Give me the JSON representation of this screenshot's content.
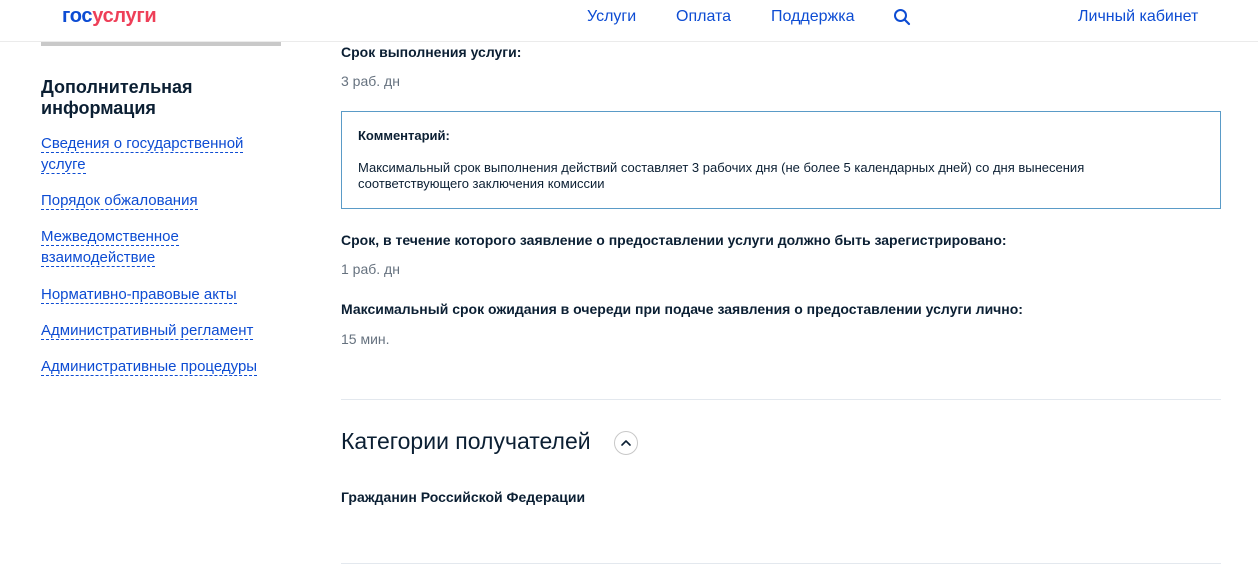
{
  "header": {
    "logo_part1": "гос",
    "logo_part2": "услуги",
    "nav": [
      "Услуги",
      "Оплата",
      "Поддержка"
    ],
    "account_link": "Личный кабинет",
    "search_icon": "search-icon"
  },
  "sidebar": {
    "title": "Дополнительная информация",
    "links": [
      "Сведения о государственной услуге",
      "Порядок обжалования",
      "Межведомственное взаимодействие",
      "Нормативно-правовые акты",
      "Административный регламент",
      "Административные процедуры"
    ]
  },
  "main": {
    "term_label": "Срок выполнения услуги:",
    "term_value": "3 раб. дн",
    "comment": {
      "title": "Комментарий:",
      "text": "Максимальный срок выполнения действий составляет 3 рабочих дня (не более 5 календарных дней) со дня вынесения соответствующего заключения комиссии"
    },
    "registration_label": "Срок, в течение которого заявление о предоставлении услуги должно быть зарегистрировано:",
    "registration_value": "1 раб. дн",
    "queue_label": "Максимальный срок ожидания в очереди при подаче заявления о предоставлении услуги лично:",
    "queue_value": "15 мин.",
    "categories_title": "Категории получателей",
    "categories": [
      "Гражданин Российской Федерации"
    ]
  },
  "colors": {
    "link": "#0d4cd3",
    "logo_red": "#ee3f58",
    "comment_border": "#5a9bc7",
    "grey_text": "#66727f"
  }
}
